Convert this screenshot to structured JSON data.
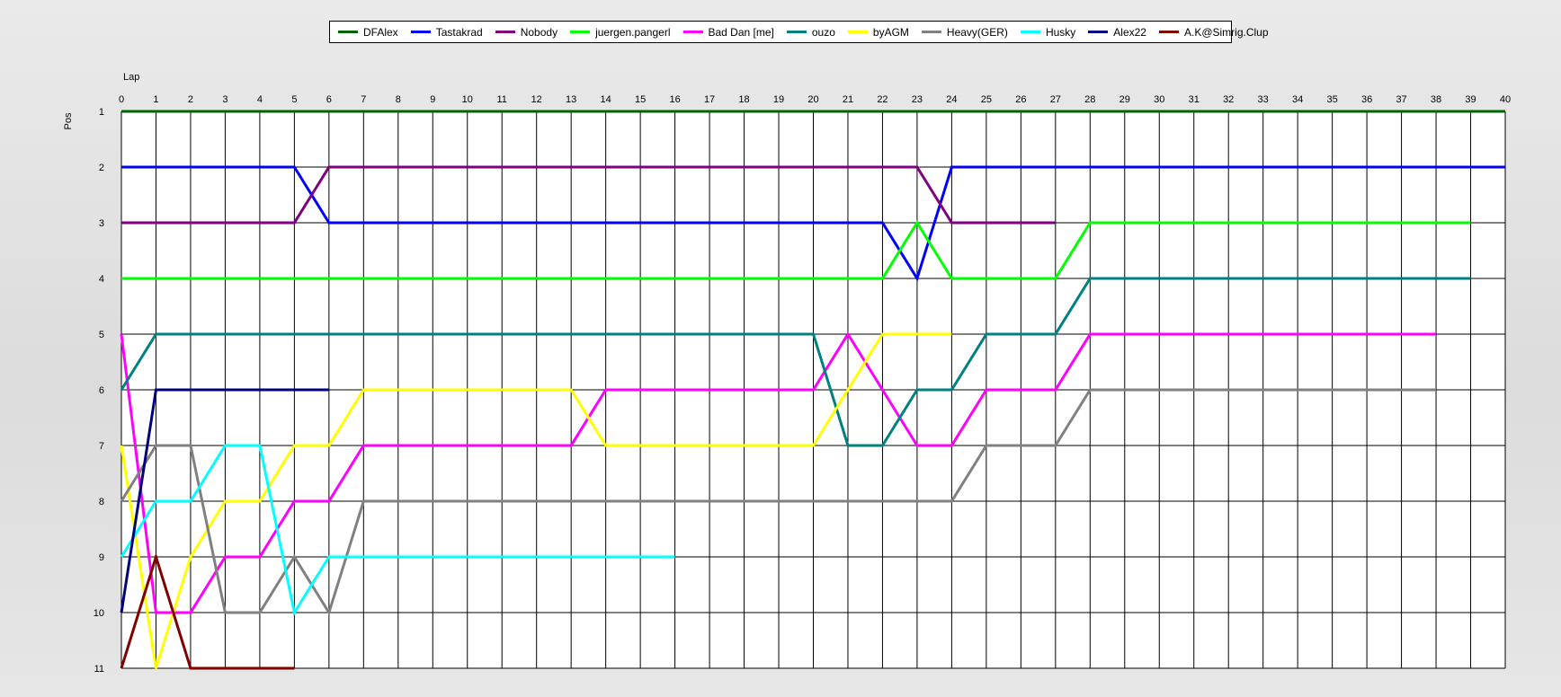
{
  "chart_data": {
    "type": "line",
    "title": "",
    "xlabel": "Lap",
    "ylabel": "Pos",
    "xlim": [
      0,
      40
    ],
    "ylim": [
      1,
      11
    ],
    "y_inverted": true,
    "grid": true,
    "legend_placement": "top-center",
    "x_ticks": [
      0,
      1,
      2,
      3,
      4,
      5,
      6,
      7,
      8,
      9,
      10,
      11,
      12,
      13,
      14,
      15,
      16,
      17,
      18,
      19,
      20,
      21,
      22,
      23,
      24,
      25,
      26,
      27,
      28,
      29,
      30,
      31,
      32,
      33,
      34,
      35,
      36,
      37,
      38,
      39,
      40
    ],
    "y_ticks": [
      1,
      2,
      3,
      4,
      5,
      6,
      7,
      8,
      9,
      10,
      11
    ],
    "series": [
      {
        "name": "DFAlex",
        "color": "#006400",
        "x": [
          0,
          40
        ],
        "y": [
          1,
          1
        ]
      },
      {
        "name": "Tastakrad",
        "color": "#0000ff",
        "x": [
          0,
          5,
          6,
          22,
          23,
          24,
          40
        ],
        "y": [
          2,
          2,
          3,
          3,
          4,
          2,
          2
        ]
      },
      {
        "name": "Nobody",
        "color": "#800080",
        "x": [
          0,
          5,
          6,
          23,
          24,
          27
        ],
        "y": [
          3,
          3,
          2,
          2,
          3,
          3
        ]
      },
      {
        "name": "juergen.pangerl",
        "color": "#00ff00",
        "x": [
          0,
          22,
          23,
          24,
          27,
          28,
          39
        ],
        "y": [
          4,
          4,
          3,
          4,
          4,
          3,
          3
        ]
      },
      {
        "name": "Bad Dan [me]",
        "color": "#ff00ff",
        "x": [
          0,
          1,
          2,
          3,
          4,
          5,
          6,
          7,
          13,
          14,
          20,
          21,
          22,
          23,
          24,
          25,
          27,
          28,
          38
        ],
        "y": [
          5,
          10,
          10,
          9,
          9,
          8,
          8,
          7,
          7,
          6,
          6,
          5,
          6,
          7,
          7,
          6,
          6,
          5,
          5
        ]
      },
      {
        "name": "ouzo",
        "color": "#008080",
        "x": [
          0,
          1,
          20,
          21,
          22,
          23,
          24,
          25,
          27,
          28,
          39
        ],
        "y": [
          6,
          5,
          5,
          7,
          7,
          6,
          6,
          5,
          5,
          4,
          4
        ]
      },
      {
        "name": "byAGM",
        "color": "#ffff00",
        "x": [
          0,
          1,
          2,
          3,
          4,
          5,
          6,
          7,
          13,
          14,
          20,
          21,
          22,
          24
        ],
        "y": [
          7,
          11,
          9,
          8,
          8,
          7,
          7,
          6,
          6,
          7,
          7,
          6,
          5,
          5
        ]
      },
      {
        "name": "Heavy(GER)",
        "color": "#808080",
        "x": [
          0,
          1,
          2,
          3,
          4,
          5,
          6,
          7,
          24,
          25,
          27,
          28,
          38
        ],
        "y": [
          8,
          7,
          7,
          10,
          10,
          9,
          10,
          8,
          8,
          7,
          7,
          6,
          6
        ]
      },
      {
        "name": "Husky",
        "color": "#00ffff",
        "x": [
          0,
          1,
          2,
          3,
          4,
          5,
          6,
          16
        ],
        "y": [
          9,
          8,
          8,
          7,
          7,
          10,
          9,
          9
        ]
      },
      {
        "name": "Alex22",
        "color": "#000080",
        "x": [
          0,
          1,
          6
        ],
        "y": [
          10,
          6,
          6
        ]
      },
      {
        "name": "A.K@Simrig.Clup",
        "color": "#800000",
        "x": [
          0,
          1,
          2,
          5
        ],
        "y": [
          11,
          9,
          11,
          11
        ]
      }
    ]
  }
}
